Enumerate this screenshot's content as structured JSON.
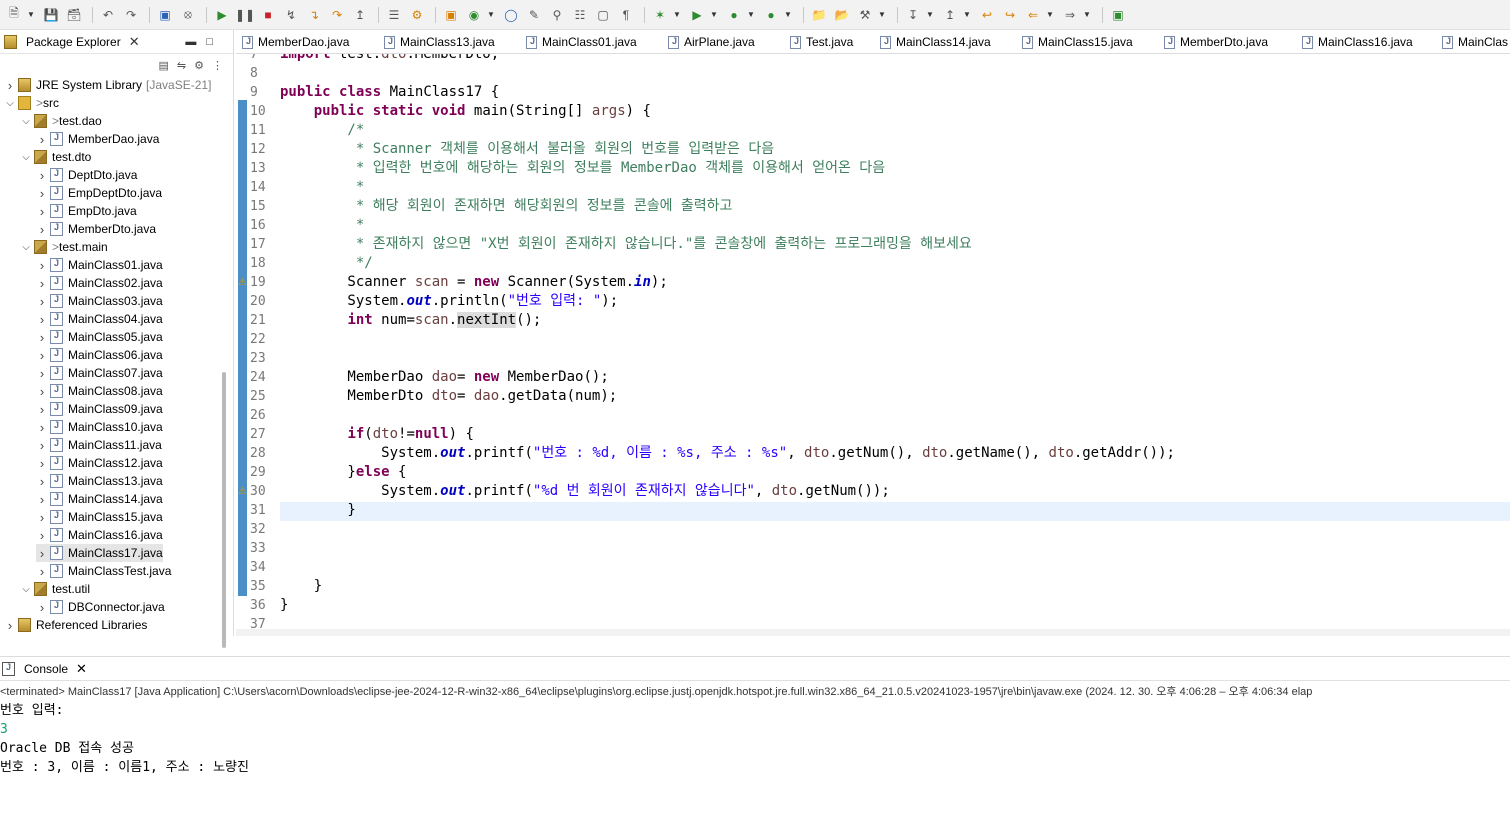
{
  "toolbar": {
    "buttons": [
      "new-icon",
      "save-icon",
      "save-all-icon",
      "undo-icon",
      "redo-icon",
      "terminal-icon",
      "skip-breakpoints-icon",
      "resume-icon",
      "suspend-icon",
      "terminate-icon",
      "disconnect-icon",
      "step-into-icon",
      "step-over-icon",
      "step-return-icon",
      "open-task-icon",
      "new-server-icon",
      "new-package-icon",
      "new-class-icon",
      "coverage-icon",
      "debug-icon",
      "run-icon",
      "run-external-icon",
      "new-java-project-icon",
      "search-icon",
      "open-type-icon",
      "annotation-icon",
      "back-icon",
      "forward-icon",
      "open-perspective-icon"
    ]
  },
  "package_explorer": {
    "title": "Package Explorer",
    "tree": [
      {
        "label": "JRE System Library",
        "suffix": "[JavaSE-21]",
        "type": "lib",
        "depth": 1,
        "expanded": false
      },
      {
        "label": "src",
        "prefix": "> ",
        "type": "src",
        "depth": 1,
        "expanded": true
      },
      {
        "label": "test.dao",
        "prefix": "> ",
        "type": "pkg",
        "depth": 2,
        "expanded": true
      },
      {
        "label": "MemberDao.java",
        "type": "java",
        "depth": 3
      },
      {
        "label": "test.dto",
        "type": "pkg",
        "depth": 2,
        "expanded": true
      },
      {
        "label": "DeptDto.java",
        "type": "java",
        "depth": 3
      },
      {
        "label": "EmpDeptDto.java",
        "type": "java",
        "depth": 3
      },
      {
        "label": "EmpDto.java",
        "type": "java",
        "depth": 3
      },
      {
        "label": "MemberDto.java",
        "type": "java",
        "depth": 3
      },
      {
        "label": "test.main",
        "prefix": "> ",
        "type": "pkg",
        "depth": 2,
        "expanded": true
      },
      {
        "label": "MainClass01.java",
        "type": "java",
        "depth": 3
      },
      {
        "label": "MainClass02.java",
        "type": "java",
        "depth": 3
      },
      {
        "label": "MainClass03.java",
        "type": "java",
        "depth": 3
      },
      {
        "label": "MainClass04.java",
        "type": "java",
        "depth": 3
      },
      {
        "label": "MainClass05.java",
        "type": "java",
        "depth": 3
      },
      {
        "label": "MainClass06.java",
        "type": "java",
        "depth": 3
      },
      {
        "label": "MainClass07.java",
        "type": "java",
        "depth": 3
      },
      {
        "label": "MainClass08.java",
        "type": "java",
        "depth": 3
      },
      {
        "label": "MainClass09.java",
        "type": "java",
        "depth": 3
      },
      {
        "label": "MainClass10.java",
        "type": "java",
        "depth": 3
      },
      {
        "label": "MainClass11.java",
        "type": "java",
        "depth": 3
      },
      {
        "label": "MainClass12.java",
        "type": "java",
        "depth": 3
      },
      {
        "label": "MainClass13.java",
        "type": "java",
        "depth": 3
      },
      {
        "label": "MainClass14.java",
        "type": "java",
        "depth": 3
      },
      {
        "label": "MainClass15.java",
        "type": "java",
        "depth": 3
      },
      {
        "label": "MainClass16.java",
        "type": "java",
        "depth": 3
      },
      {
        "label": "MainClass17.java",
        "type": "java",
        "depth": 3,
        "selected": true
      },
      {
        "label": "MainClassTest.java",
        "type": "java",
        "depth": 3
      },
      {
        "label": "test.util",
        "type": "pkg",
        "depth": 2,
        "expanded": true
      },
      {
        "label": "DBConnector.java",
        "type": "java",
        "depth": 3
      },
      {
        "label": "Referenced Libraries",
        "type": "lib",
        "depth": 1,
        "expanded": false
      }
    ]
  },
  "editor_tabs": [
    "MemberDao.java",
    "MainClass13.java",
    "MainClass01.java",
    "AirPlane.java",
    "Test.java",
    "MainClass14.java",
    "MainClass15.java",
    "MemberDto.java",
    "MainClass16.java",
    "MainClas"
  ],
  "editor": {
    "line_numbers": [
      "7",
      "8",
      "9",
      "10",
      "11",
      "12",
      "13",
      "14",
      "15",
      "16",
      "17",
      "18",
      "19",
      "20",
      "21",
      "22",
      "23",
      "24",
      "25",
      "26",
      "27",
      "28",
      "29",
      "30",
      "31",
      "32",
      "33",
      "34",
      "35",
      "36",
      "37"
    ],
    "lines": [
      "import test.dto.MemberDto;",
      "",
      "public class MainClass17 {",
      "    public static void main(String[] args) {",
      "        /*",
      "         * Scanner 객체를 이용해서 불러올 회원의 번호를 입력받은 다음",
      "         * 입력한 번호에 해당하는 회원의 정보를 MemberDao 객체를 이용해서 얻어온 다음",
      "         *",
      "         * 해당 회원이 존재하면 해당회원의 정보를 콘솔에 출력하고",
      "         *",
      "         * 존재하지 않으면 \"X번 회원이 존재하지 않습니다.\"를 콘솔창에 출력하는 프로그래밍을 해보세요",
      "         */",
      "        Scanner scan = new Scanner(System.in);",
      "        System.out.println(\"번호 입력: \");",
      "        int num=scan.nextInt();",
      "",
      "",
      "        MemberDao dao= new MemberDao();",
      "        MemberDto dto= dao.getData(num);",
      "",
      "        if(dto!=null) {",
      "            System.out.printf(\"번호 : %d, 이름 : %s, 주소 : %s\", dto.getNum(), dto.getName(), dto.getAddr());",
      "        }else {",
      "            System.out.printf(\"%d 번 회원이 존재하지 않습니다\", dto.getNum());",
      "        }",
      "",
      "",
      "",
      "    }",
      "}",
      ""
    ]
  },
  "console": {
    "title": "Console",
    "status": "<terminated> MainClass17 [Java Application] C:\\Users\\acorn\\Downloads\\eclipse-jee-2024-12-R-win32-x86_64\\eclipse\\plugins\\org.eclipse.justj.openjdk.hotspot.jre.full.win32.x86_64_21.0.5.v20241023-1957\\jre\\bin\\javaw.exe  (2024. 12. 30. 오후 4:06:28 – 오후 4:06:34 elap",
    "output": [
      "번호 입력: ",
      "3",
      "Oracle DB 접속 성공",
      "번호 : 3, 이름 : 이름1, 주소 : 노량진"
    ]
  }
}
